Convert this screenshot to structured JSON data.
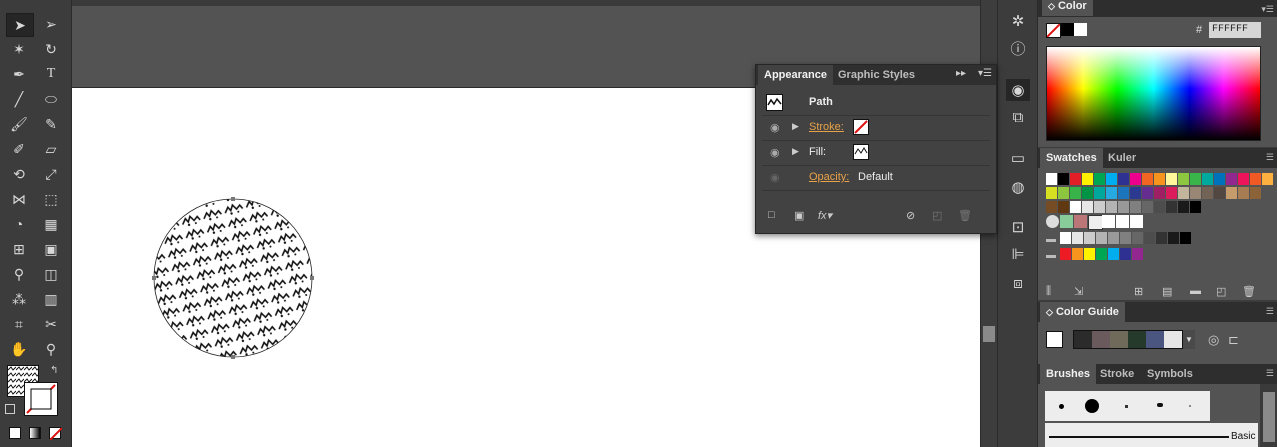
{
  "canvas": {
    "bg": "#535353",
    "artboard": "#ffffff"
  },
  "toolbar": {
    "tools": [
      "selection-icon",
      "direct-selection-icon",
      "magic-wand-icon",
      "lasso-icon",
      "pen-icon",
      "type-icon",
      "line-segment-icon",
      "ellipse-icon",
      "paintbrush-icon",
      "pencil-icon",
      "blob-brush-icon",
      "eraser-icon",
      "rotate-icon",
      "scale-icon",
      "width-icon",
      "free-transform-icon",
      "shape-builder-icon",
      "perspective-grid-icon",
      "mesh-icon",
      "gradient-icon",
      "eyedropper-icon",
      "blend-icon",
      "symbol-sprayer-icon",
      "column-graph-icon",
      "artboard-icon",
      "slice-icon",
      "hand-icon",
      "zoom-icon"
    ]
  },
  "appearance": {
    "tabs": [
      "Appearance",
      "Graphic Styles"
    ],
    "object": "Path",
    "stroke_label": "Stroke:",
    "fill_label": "Fill:",
    "opacity_label": "Opacity:",
    "opacity_value": "Default"
  },
  "color": {
    "tab": "Color",
    "hash": "#",
    "hex_value": "FFFFFF"
  },
  "swatches": {
    "tabs": [
      "Swatches",
      "Kuler"
    ],
    "row1": [
      "#ffffff",
      "#000000",
      "#e41e26",
      "#fff200",
      "#00a651",
      "#00aeef",
      "#2e3192",
      "#ec008c",
      "#f26522",
      "#f7941d",
      "#fff799",
      "#8dc63f",
      "#39b54a",
      "#00a99d",
      "#0072bc",
      "#92278f",
      "#ed145b",
      "#f15a24",
      "#fbb040"
    ],
    "row2": [
      "#d7df23",
      "#8cc63f",
      "#37b34a",
      "#009444",
      "#00a79d",
      "#27aae1",
      "#1c75bc",
      "#2b3990",
      "#662d91",
      "#9e1f63",
      "#da1c5c",
      "#c2b59b",
      "#998675",
      "#736357",
      "#534741",
      "#c69c6d",
      "#a67c52",
      "#8c6239"
    ],
    "row3": [
      "#754c24",
      "#603913",
      "#ffffff",
      "#e6e6e6",
      "#cccccc",
      "#b3b3b3",
      "#999999",
      "#808080",
      "#666666",
      "#4d4d4d",
      "#333333",
      "#1a1a1a",
      "#000000"
    ],
    "row4": [
      "#ed1c24",
      "#f7941d",
      "#fff200",
      "#00a651",
      "#00aeef",
      "#2e3192",
      "#92278f"
    ]
  },
  "color_guide": {
    "tab": "Color Guide",
    "harmony": [
      "#2b2b2b",
      "#6b5a5d",
      "#6f6a59",
      "#263a2c",
      "#4a5580",
      "#e6e6e6"
    ]
  },
  "brushes": {
    "tabs": [
      "Brushes",
      "Stroke",
      "Symbols"
    ],
    "basic": "Basic"
  }
}
